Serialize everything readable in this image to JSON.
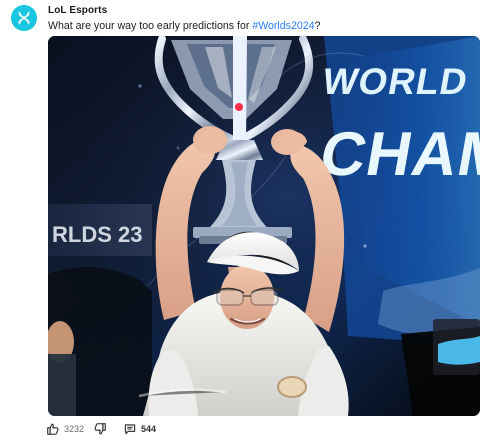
{
  "post": {
    "author": "LoL Esports",
    "text_prefix": "What are your way too early predictions for ",
    "hashtag": "#Worlds2024",
    "text_suffix": "?"
  },
  "media": {
    "icon": "trophy-photo",
    "banner_text_1": "WORLD",
    "banner_text_2": "CHAM",
    "screen_text": "RLDS 23"
  },
  "actions": {
    "like_count": "3232",
    "comment_count": "544"
  },
  "colors": {
    "avatar": "#18c6df",
    "hashtag": "#2b7cff"
  }
}
